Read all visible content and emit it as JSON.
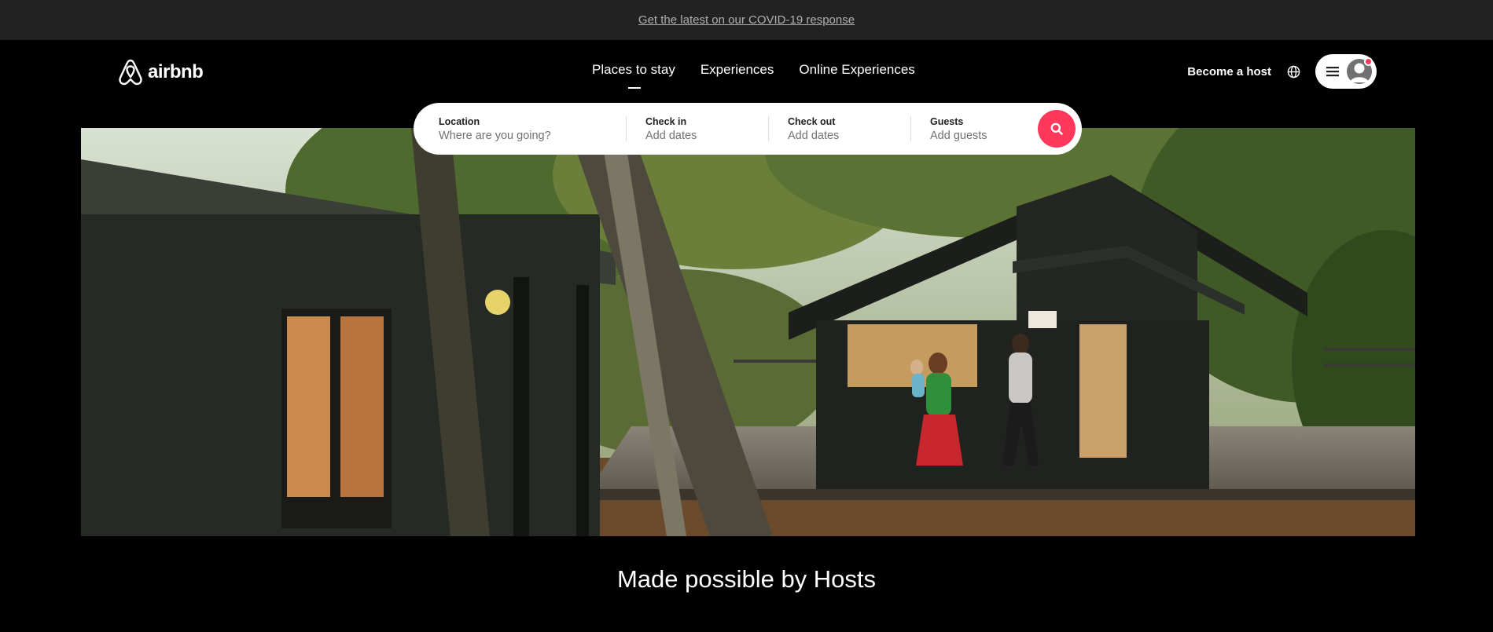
{
  "banner": {
    "covid_link": "Get the latest on our COVID-19 response"
  },
  "header": {
    "logo_text": "airbnb",
    "tabs": [
      {
        "label": "Places to stay",
        "active": true
      },
      {
        "label": "Experiences",
        "active": false
      },
      {
        "label": "Online Experiences",
        "active": false
      }
    ],
    "become_host": "Become a host",
    "icons": {
      "globe": "globe-icon",
      "menu": "hamburger-menu-icon",
      "avatar": "user-avatar-icon"
    }
  },
  "search": {
    "location": {
      "label": "Location",
      "placeholder": "Where are you going?"
    },
    "check_in": {
      "label": "Check in",
      "placeholder": "Add dates"
    },
    "check_out": {
      "label": "Check out",
      "placeholder": "Add dates"
    },
    "guests": {
      "label": "Guests",
      "placeholder": "Add guests"
    },
    "button_icon": "search-icon"
  },
  "hero": {
    "image": "cabin-hosts-photo"
  },
  "tagline": "Made possible by Hosts",
  "colors": {
    "brand": "#ff385c",
    "banner_bg": "#222222",
    "page_bg": "#000000"
  }
}
